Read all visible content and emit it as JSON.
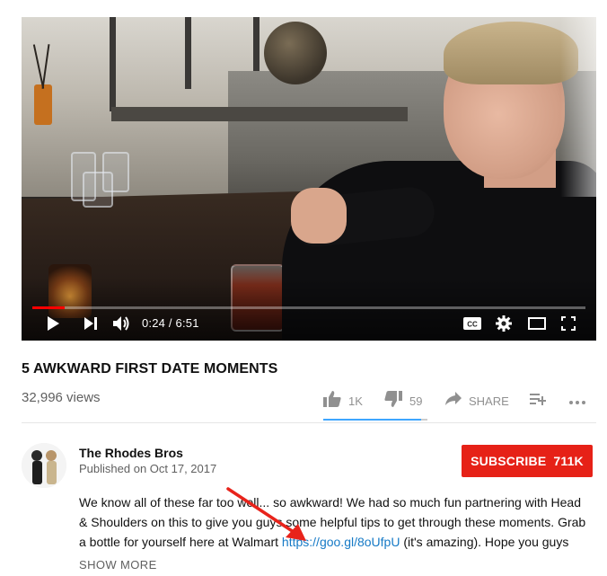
{
  "player": {
    "time_current": "0:24",
    "time_separator": " / ",
    "time_total": "6:51",
    "progress_fraction": 0.058,
    "icons": {
      "play": "play-icon",
      "next": "next-icon",
      "volume": "volume-icon",
      "captions": "captions-icon",
      "settings": "gear-icon",
      "theater": "theater-mode-icon",
      "fullscreen": "fullscreen-icon"
    }
  },
  "video": {
    "title": "5 AWKWARD FIRST DATE MOMENTS",
    "views": "32,996 views",
    "likes": "1K",
    "dislikes": "59",
    "share_label": "SHARE",
    "like_fraction": 0.94
  },
  "channel": {
    "name": "The Rhodes Bros",
    "published": "Published on Oct 17, 2017",
    "subscribe_label": "SUBSCRIBE",
    "subscriber_count": "711K"
  },
  "description": {
    "text_before_link": "We know all of these far too well... so awkward! We had so much fun partnering with Head & Shoulders on this to give you guys some helpful tips to get through these moments. Grab a bottle for yourself here at Walmart ",
    "link": "https://goo.gl/8oUfpU",
    "text_after_link": " (it's amazing). Hope you guys",
    "show_more_label": "SHOW MORE"
  },
  "colors": {
    "accent_red": "#e62117",
    "progress_red": "#ff0000",
    "link_blue": "#167ac6",
    "like_bar_blue": "#3ea6ff",
    "annotation_arrow": "#e8231b"
  }
}
